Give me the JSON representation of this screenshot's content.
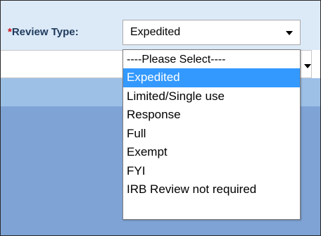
{
  "form": {
    "review_type": {
      "required_marker": "*",
      "label": "Review Type:",
      "selected_value": "Expedited",
      "options": [
        "----Please Select----",
        "Expedited",
        "Limited/Single use",
        "Response",
        "Full",
        "Exempt",
        "FYI",
        "IRB Review not required"
      ],
      "highlighted_index": 1
    }
  },
  "colors": {
    "label_text": "#1f3a5c",
    "required_marker": "#d0121a",
    "highlight": "#3399ff",
    "band_top": "#dceaf8",
    "band_mid": "#9dc0e6",
    "band_bottom": "#7fa3d5"
  },
  "icons": {
    "select_arrow": "chevron-down-icon",
    "select_arrow_2": "chevron-down-icon"
  }
}
